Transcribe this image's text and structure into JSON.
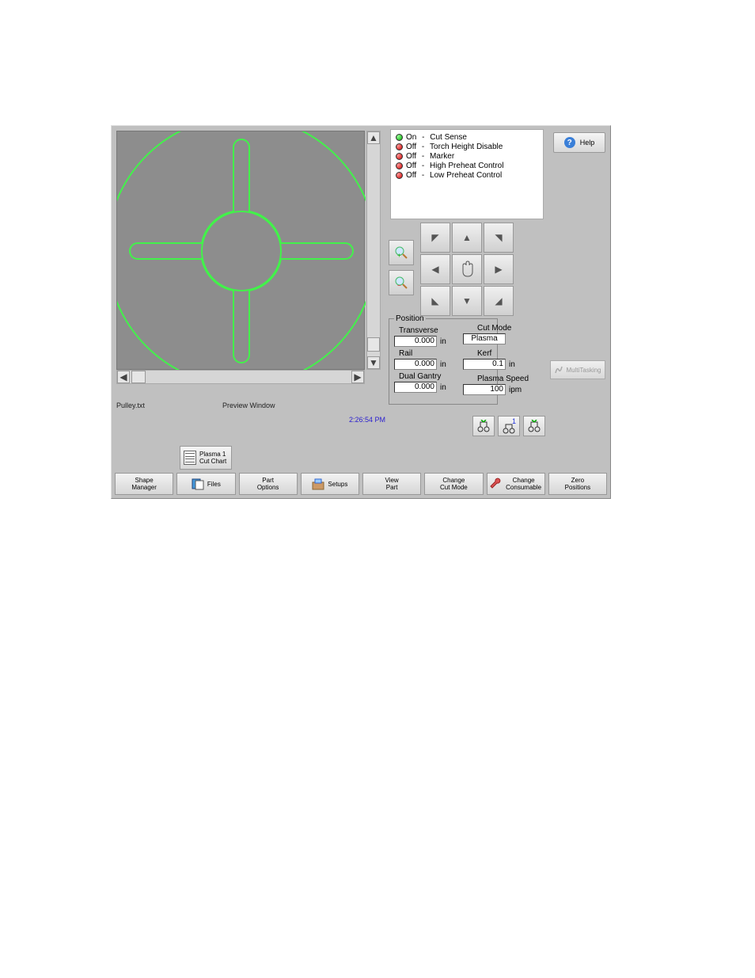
{
  "status": {
    "items": [
      {
        "state": "On",
        "led": "green",
        "label": "Cut Sense"
      },
      {
        "state": "Off",
        "led": "red",
        "label": "Torch Height Disable"
      },
      {
        "state": "Off",
        "led": "red",
        "label": "Marker"
      },
      {
        "state": "Off",
        "led": "red",
        "label": "High Preheat Control"
      },
      {
        "state": "Off",
        "led": "red",
        "label": "Low Preheat Control"
      }
    ]
  },
  "help": {
    "label": "Help"
  },
  "preview": {
    "filename": "Pulley.txt",
    "label": "Preview Window"
  },
  "clock": "2:26:54 PM",
  "position": {
    "legend": "Position",
    "transverse": {
      "label": "Transverse",
      "value": "0.000",
      "unit": "in"
    },
    "rail": {
      "label": "Rail",
      "value": "0.000",
      "unit": "in"
    },
    "dual_gantry": {
      "label": "Dual Gantry",
      "value": "0.000",
      "unit": "in"
    }
  },
  "cut_mode": {
    "label": "Cut Mode",
    "value": "Plasma"
  },
  "kerf": {
    "label": "Kerf",
    "value": "0.1",
    "unit": "in"
  },
  "plasma_speed": {
    "label": "Plasma Speed",
    "value": "100",
    "unit": "ipm"
  },
  "multitasking": {
    "label": "MultiTasking"
  },
  "torch": {
    "count_label": "1"
  },
  "cut_chart": {
    "label": "Plasma 1\nCut Chart"
  },
  "bottom": {
    "shape_manager": "Shape\nManager",
    "files": "Files",
    "part_options": "Part\nOptions",
    "setups": "Setups",
    "view_part": "View\nPart",
    "change_cut_mode": "Change\nCut Mode",
    "change_consumable": "Change\nConsumable",
    "zero_positions": "Zero\nPositions"
  }
}
